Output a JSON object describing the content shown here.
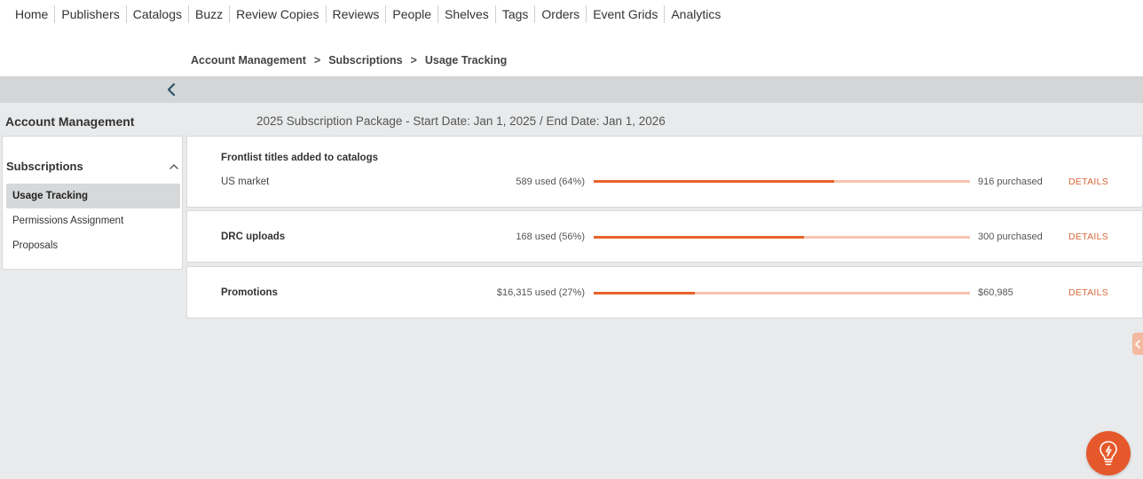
{
  "nav": {
    "items": [
      "Home",
      "Publishers",
      "Catalogs",
      "Buzz",
      "Review Copies",
      "Reviews",
      "People",
      "Shelves",
      "Tags",
      "Orders",
      "Event Grids",
      "Analytics"
    ]
  },
  "breadcrumb": {
    "items": [
      "Account Management",
      "Subscriptions",
      "Usage Tracking"
    ],
    "separator": ">"
  },
  "section_title": "Account Management",
  "package_info": "2025 Subscription Package - Start Date: Jan 1, 2025 / End Date: Jan 1, 2026",
  "sidebar": {
    "header": "Subscriptions",
    "items": [
      {
        "label": "Usage Tracking",
        "active": true
      },
      {
        "label": "Permissions Assignment",
        "active": false
      },
      {
        "label": "Proposals",
        "active": false
      }
    ]
  },
  "cards": [
    {
      "title": "Frontlist titles added to catalogs",
      "row_label": "US market",
      "used_text": "589 used (64%)",
      "percent": 64,
      "purchased_text": "916 purchased",
      "details_label": "DETAILS"
    },
    {
      "title": "DRC uploads",
      "used_text": "168 used (56%)",
      "percent": 56,
      "purchased_text": "300 purchased",
      "details_label": "DETAILS"
    },
    {
      "title": "Promotions",
      "used_text": "$16,315 used (27%)",
      "percent": 27,
      "purchased_text": "$60,985",
      "details_label": "DETAILS"
    }
  ],
  "colors": {
    "accent": "#e8622a",
    "bar_track": "#f6c4b0",
    "details_link": "#d9683b",
    "fab": "#e5582b"
  },
  "icons": {
    "collapse": "chevron-left-icon",
    "sidebar_toggle": "chevron-up-icon",
    "edge_tab": "chevron-left-icon",
    "fab": "lightbulb-icon"
  }
}
